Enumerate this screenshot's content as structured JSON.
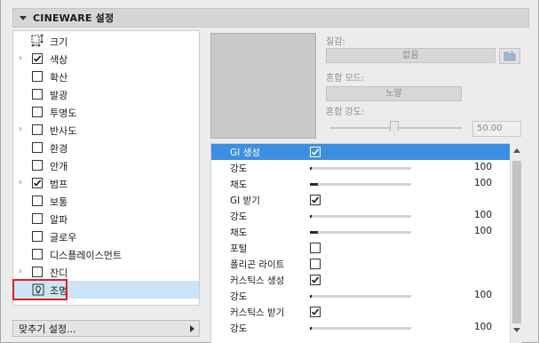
{
  "header": {
    "title": "CINEWARE 설정"
  },
  "channels": [
    {
      "label": "크기",
      "kind": "size",
      "arrow": false,
      "checked": null
    },
    {
      "label": "색상",
      "kind": "checkbox",
      "arrow": true,
      "checked": true
    },
    {
      "label": "확산",
      "kind": "checkbox",
      "arrow": false,
      "checked": false
    },
    {
      "label": "발광",
      "kind": "checkbox",
      "arrow": false,
      "checked": false
    },
    {
      "label": "투명도",
      "kind": "checkbox",
      "arrow": false,
      "checked": false
    },
    {
      "label": "반사도",
      "kind": "checkbox",
      "arrow": true,
      "checked": false
    },
    {
      "label": "환경",
      "kind": "checkbox",
      "arrow": false,
      "checked": false
    },
    {
      "label": "안개",
      "kind": "checkbox",
      "arrow": false,
      "checked": false
    },
    {
      "label": "범프",
      "kind": "checkbox",
      "arrow": true,
      "checked": true
    },
    {
      "label": "보통",
      "kind": "checkbox",
      "arrow": false,
      "checked": false
    },
    {
      "label": "알파",
      "kind": "checkbox",
      "arrow": false,
      "checked": false
    },
    {
      "label": "글로우",
      "kind": "checkbox",
      "arrow": false,
      "checked": false
    },
    {
      "label": "디스플레이스먼트",
      "kind": "checkbox",
      "arrow": false,
      "checked": false
    },
    {
      "label": "잔디",
      "kind": "checkbox",
      "arrow": true,
      "checked": false
    },
    {
      "label": "조명",
      "kind": "light",
      "arrow": false,
      "checked": null,
      "selected": true
    }
  ],
  "fit_settings": {
    "label": "맞추기 설정..."
  },
  "material": {
    "texture_label": "질감:",
    "texture_value": "없음",
    "blend_mode_label": "혼합 모드:",
    "blend_mode_value": "노말",
    "blend_strength_label": "혼합 강도:",
    "blend_strength_value": "50.00",
    "blend_strength_level": 0.5
  },
  "params": [
    {
      "label": "GI 생성",
      "type": "checkbox",
      "checked": true,
      "selected": true
    },
    {
      "label": "강도",
      "type": "slider",
      "value": "100",
      "level": 0.01
    },
    {
      "label": "채도",
      "type": "slider",
      "value": "100",
      "level": 0.08
    },
    {
      "label": "GI 받기",
      "type": "checkbox",
      "checked": true
    },
    {
      "label": "강도",
      "type": "slider",
      "value": "100",
      "level": 0.01
    },
    {
      "label": "채도",
      "type": "slider",
      "value": "100",
      "level": 0.08
    },
    {
      "label": "포털",
      "type": "checkbox",
      "checked": false
    },
    {
      "label": "폴리곤 라이트",
      "type": "checkbox",
      "checked": false
    },
    {
      "label": "커스틱스 생성",
      "type": "checkbox",
      "checked": true
    },
    {
      "label": "강도",
      "type": "slider",
      "value": "100",
      "level": 0.01
    },
    {
      "label": "커스틱스 받기",
      "type": "checkbox",
      "checked": true
    },
    {
      "label": "강도",
      "type": "slider",
      "value": "100",
      "level": 0.01
    }
  ],
  "colors": {
    "selected_row": "#3c8ee0",
    "selected_list_row": "#cce4f7",
    "callout": "#e02020"
  }
}
